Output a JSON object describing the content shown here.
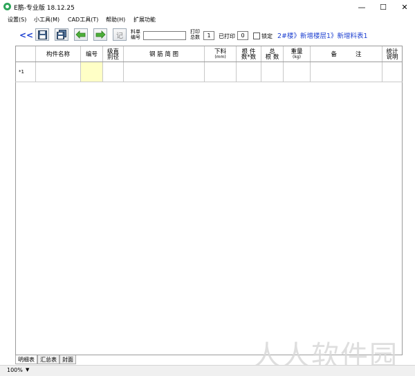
{
  "window": {
    "title": "E筋-专业版 18.12.25",
    "controls": {
      "minimize": "—",
      "maximize": "☐",
      "close": "✕"
    }
  },
  "menu": [
    "设置(S)",
    "小工具(M)",
    "CAD工具(T)",
    "帮助(H)",
    "扩展功能"
  ],
  "toolbar": {
    "back_label": "<<",
    "save_icon": "save-icon",
    "saveall_icon": "save-all-icon",
    "undo_icon": "undo-icon",
    "redo_icon": "redo-icon",
    "note_label": "记",
    "material_no_label_1": "料单",
    "material_no_label_2": "编号",
    "material_no_value": "",
    "print_count_label_1": "打印",
    "print_count_label_2": "总数",
    "print_count_value": "1",
    "printed_label": "已打印",
    "printed_value": "0",
    "lock_label": "锁定",
    "breadcrumb": "2#楼》新增楼层1》新增料表1"
  },
  "table": {
    "headers": {
      "name": "构件名称",
      "code": "编号",
      "grade": [
        "级直",
        "别径"
      ],
      "shape": "钢 筋 简 图",
      "cut": [
        "下料",
        "(mm)"
      ],
      "count": [
        "根 件",
        "数*数"
      ],
      "total": [
        "总",
        "根 数"
      ],
      "weight": [
        "重量",
        "(kg)"
      ],
      "note": "备          注",
      "stat": [
        "统计",
        "说明"
      ]
    },
    "rows": [
      {
        "marker": "*1"
      }
    ]
  },
  "tabs": [
    "明细表",
    "汇总表",
    "封面"
  ],
  "status": {
    "zoom": "100%"
  },
  "watermark": "人人软件园",
  "colors": {
    "accent": "#1c3fd0",
    "highlight_cell": "#ffffc6",
    "app_icon": "#2ea55a"
  }
}
